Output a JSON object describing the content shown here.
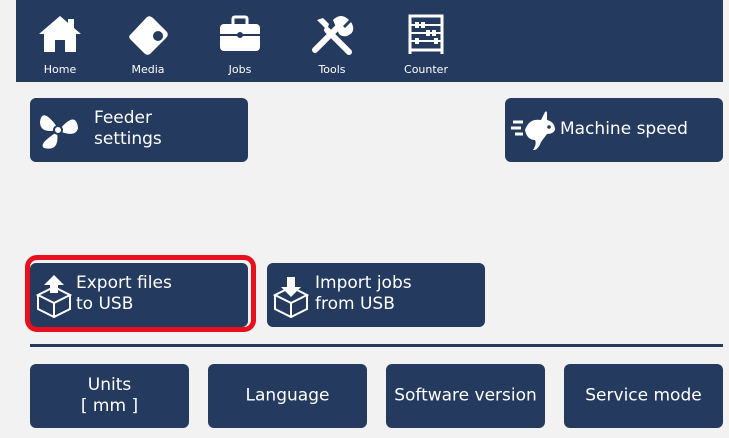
{
  "nav": {
    "items": [
      {
        "label": "Home",
        "icon": "home-icon"
      },
      {
        "label": "Media",
        "icon": "media-icon"
      },
      {
        "label": "Jobs",
        "icon": "jobs-briefcase-icon"
      },
      {
        "label": "Tools",
        "icon": "tools-icon"
      },
      {
        "label": "Counter",
        "icon": "counter-abacus-icon"
      }
    ],
    "colors": {
      "bar": "#243a5e",
      "text": "#ffffff"
    }
  },
  "buttons": {
    "feeder": {
      "line1": "Feeder",
      "line2": "settings",
      "icon": "fan-icon"
    },
    "machine_speed": {
      "label": "Machine speed",
      "icon": "rabbit-speed-icon"
    },
    "export": {
      "line1": "Export files",
      "line2": "to USB",
      "icon": "box-upload-icon",
      "highlighted": true
    },
    "import": {
      "line1": "Import jobs",
      "line2": "from USB",
      "icon": "box-download-icon"
    },
    "units": {
      "line1": "Units",
      "line2": "[ mm ]"
    },
    "language": {
      "label": "Language"
    },
    "software_version": {
      "label": "Software version"
    },
    "service_mode": {
      "label": "Service mode"
    }
  },
  "colors": {
    "button": "#243a5e",
    "background": "#f2f2f2",
    "highlight": "#e8101c"
  }
}
